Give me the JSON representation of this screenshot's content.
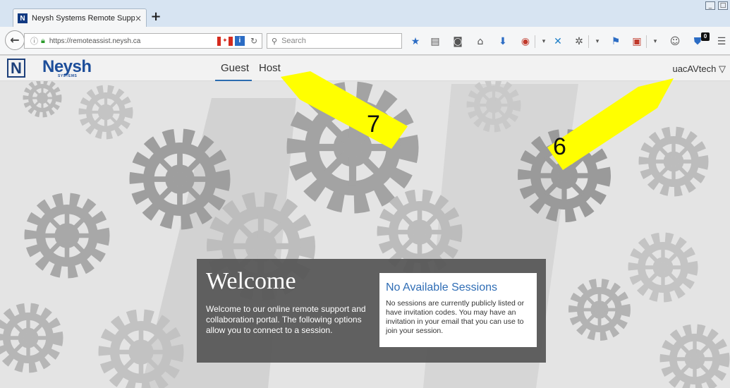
{
  "browser": {
    "tab_title": "Neysh Systems Remote Supp...",
    "tab_favicon": "N",
    "tab_close": "×",
    "new_tab": "+",
    "url": "https://remoteassist.neysh.ca",
    "search_placeholder": "Search",
    "notification_count": "0"
  },
  "site": {
    "logo_mark": "N",
    "logo_text": "Neysh",
    "logo_subtext": "SYSTEMS",
    "nav": {
      "guest": "Guest",
      "host": "Host"
    },
    "user": "uacAVtech ▽"
  },
  "annotations": {
    "label_7": "7",
    "label_6": "6",
    "color": "#ffff00"
  },
  "welcome": {
    "title": "Welcome",
    "text": "Welcome to our online remote support and collaboration portal. The following options allow you to connect to a session.",
    "sessions_title": "No Available Sessions",
    "sessions_text": "No sessions are currently publicly listed or have invitation codes. You may have an invitation in your email that you can use to join your session."
  },
  "colors": {
    "brand_blue": "#1d4e9a",
    "link_blue": "#2f6db5",
    "panel_gray": "#555555"
  }
}
